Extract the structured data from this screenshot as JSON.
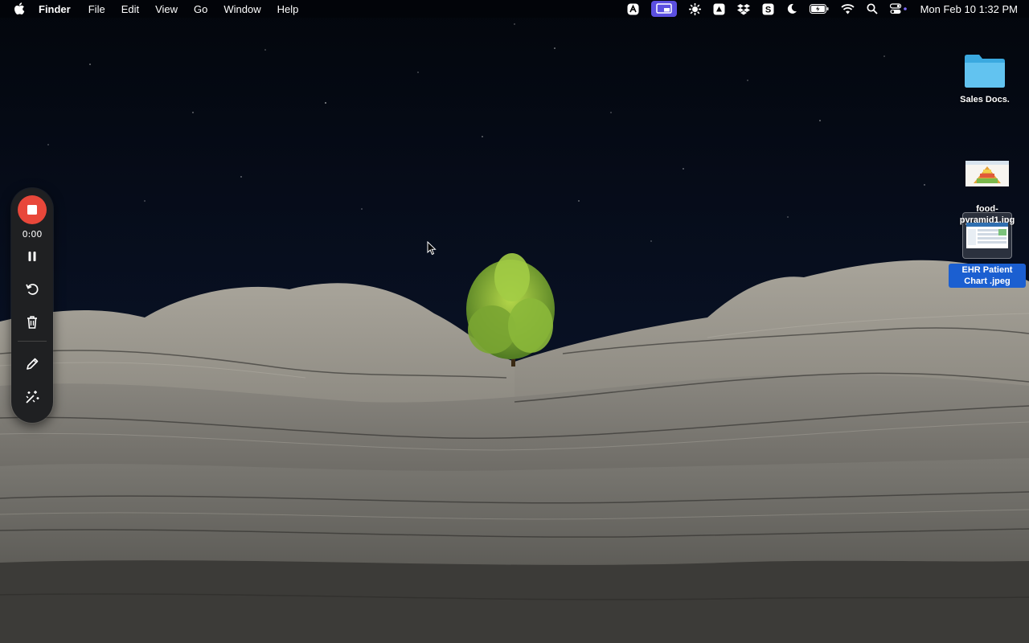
{
  "menubar": {
    "app_name": "Finder",
    "menus": [
      "File",
      "Edit",
      "View",
      "Go",
      "Window",
      "Help"
    ],
    "status_icons": [
      "app-a-icon",
      "screen-share-icon",
      "gear-sun-icon",
      "drive-icon",
      "dropbox-icon",
      "s-app-icon",
      "moon-icon",
      "battery-icon",
      "wifi-icon",
      "search-icon",
      "control-center-icon"
    ],
    "clock": "Mon Feb 10  1:32 PM"
  },
  "desktop": {
    "icons": [
      {
        "label": "Sales Docs.",
        "type": "folder-icon"
      },
      {
        "label": "food-pyramid1.jpg",
        "type": "image-thumbnail"
      },
      {
        "label": "EHR Patient Chart .jpeg",
        "type": "image-thumbnail",
        "selected": true
      }
    ]
  },
  "recorder": {
    "time": "0:00",
    "buttons": [
      "stop-recording-button",
      "pause-button",
      "restart-button",
      "delete-button",
      "draw-button",
      "effects-button"
    ],
    "accent_color": "#e8473a"
  }
}
